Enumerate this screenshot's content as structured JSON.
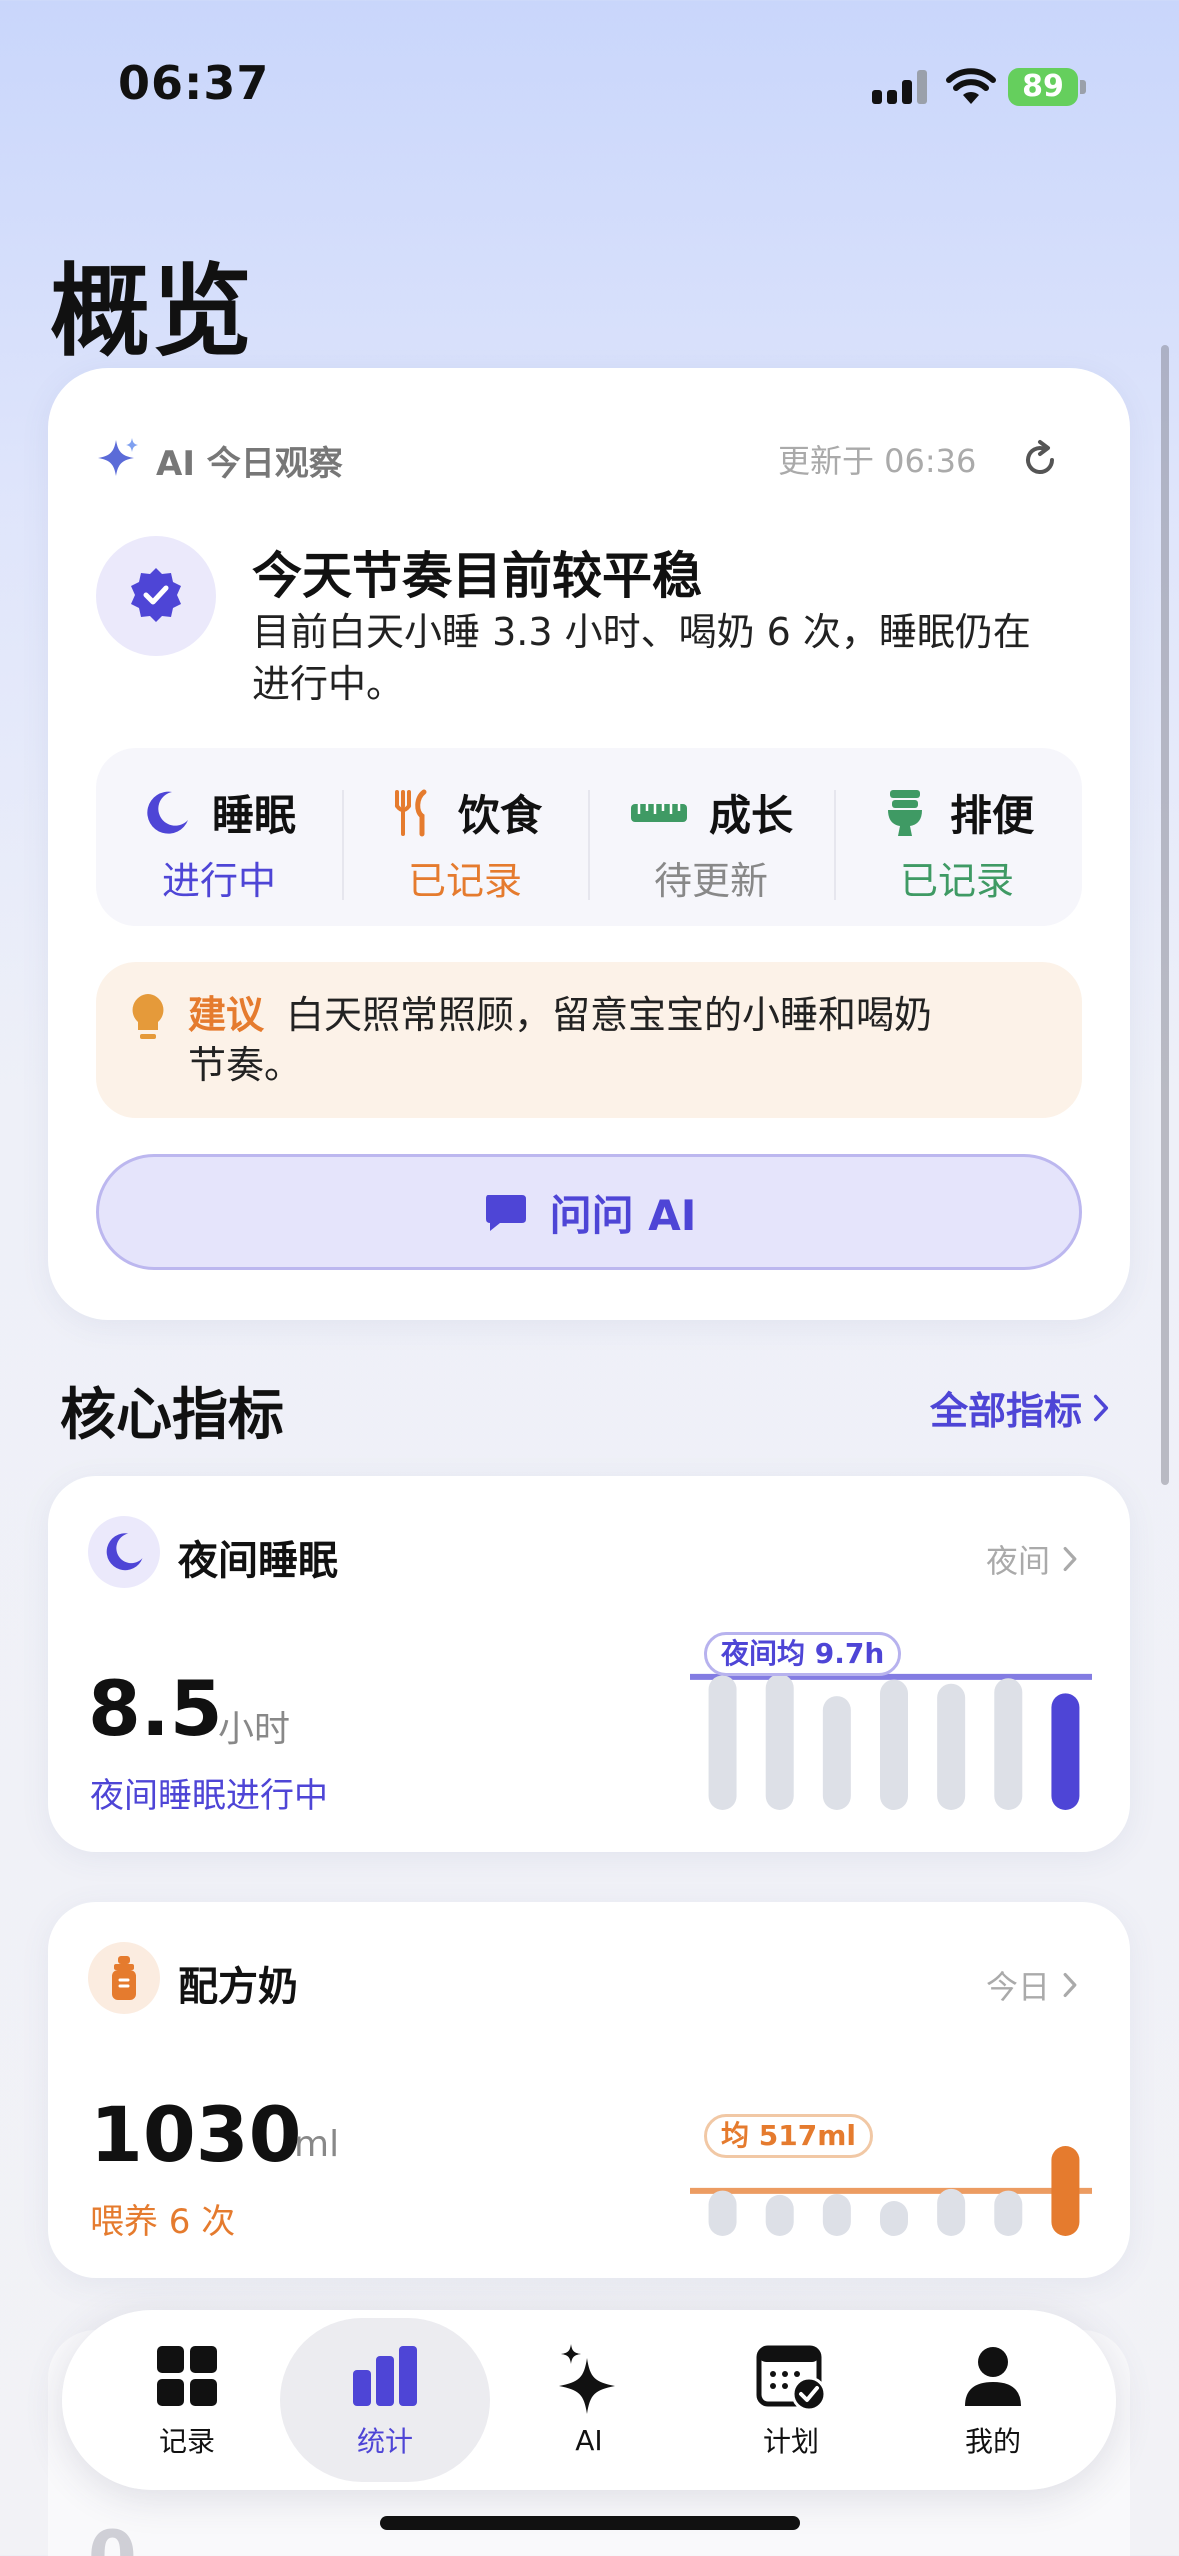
{
  "status_bar": {
    "time": "06:37",
    "battery": "89"
  },
  "page_title": "概览",
  "ai_card": {
    "label": "AI 今日观察",
    "updated": "更新于 06:36",
    "headline": "今天节奏目前较平稳",
    "summary": "目前白天小睡 3.3 小时、喝奶 6 次，睡眠仍在进行中。",
    "stats": [
      {
        "name": "睡眠",
        "value": "进行中",
        "color": "#4e45d6",
        "icon": "moon-icon"
      },
      {
        "name": "饮食",
        "value": "已记录",
        "color": "#e57b2e",
        "icon": "fork-knife-icon"
      },
      {
        "name": "成长",
        "value": "待更新",
        "color": "#888888",
        "icon": "ruler-icon"
      },
      {
        "name": "排便",
        "value": "已记录",
        "color": "#3f9a64",
        "icon": "toilet-icon"
      }
    ],
    "tip_label": "建议",
    "tip_text": "白天照常照顾，留意宝宝的小睡和喝奶节奏。",
    "ask_button": "问问 AI"
  },
  "core_metrics": {
    "title": "核心指标",
    "all_link": "全部指标",
    "sleep": {
      "title": "夜间睡眠",
      "period": "夜间",
      "value": "8.5",
      "unit": "小时",
      "sub": "夜间睡眠进行中",
      "avg_label": "夜间均 9.7h",
      "accent": "#4e45d6",
      "bars": [
        9.8,
        9.9,
        8.3,
        9.5,
        9.2,
        9.6,
        8.5
      ],
      "avg": 9.7,
      "max": 10.2
    },
    "formula": {
      "title": "配方奶",
      "period": "今日",
      "value": "1030",
      "unit": "ml",
      "sub": "喂养 6 次",
      "avg_label": "均 517ml",
      "accent": "#e57b2e",
      "bars": [
        520,
        470,
        480,
        400,
        540,
        520,
        1030
      ],
      "avg": 517,
      "max": 1030
    }
  },
  "tabs": [
    {
      "label": "记录",
      "icon": "grid-icon"
    },
    {
      "label": "统计",
      "icon": "bar-chart-icon",
      "active": true
    },
    {
      "label": "AI",
      "icon": "sparkle-icon"
    },
    {
      "label": "计划",
      "icon": "calendar-check-icon"
    },
    {
      "label": "我的",
      "icon": "person-icon"
    }
  ]
}
